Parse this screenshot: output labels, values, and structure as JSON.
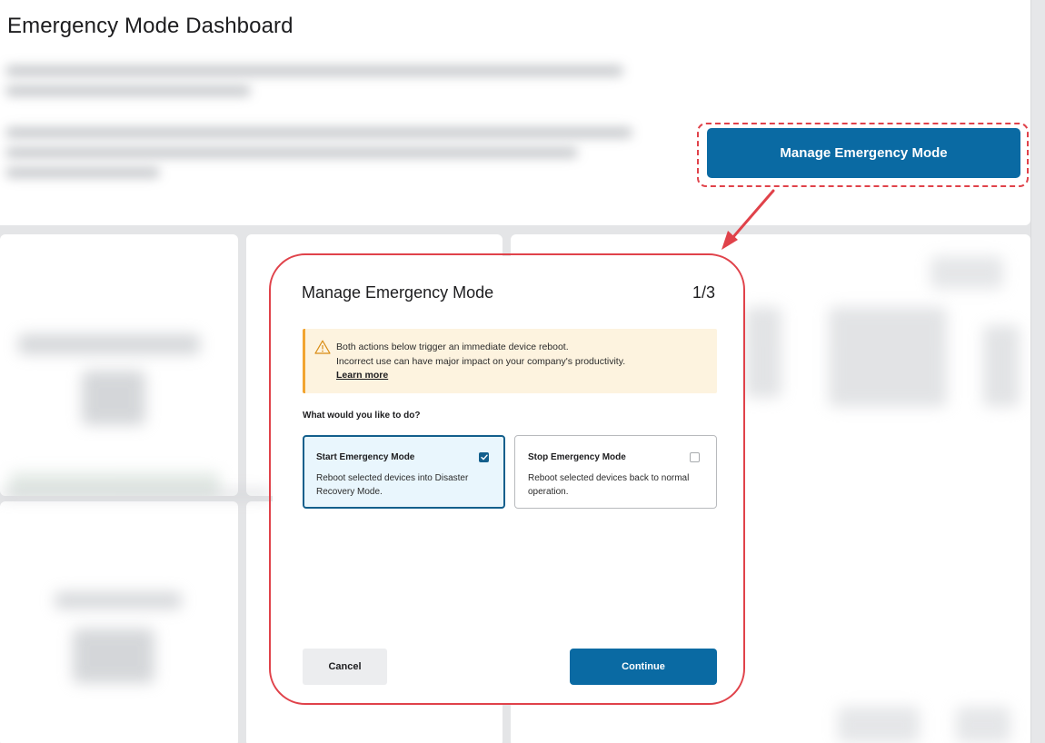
{
  "page": {
    "title": "Emergency Mode Dashboard",
    "manage_button": "Manage Emergency Mode"
  },
  "modal": {
    "title": "Manage Emergency Mode",
    "step": "1/3",
    "warning": {
      "line1": "Both actions below trigger an immediate device reboot.",
      "line2": "Incorrect use can have major impact on your company's productivity.",
      "link": "Learn more"
    },
    "question": "What would you like to do?",
    "options": [
      {
        "title": "Start Emergency Mode",
        "description": "Reboot selected devices into Disaster Recovery Mode.",
        "checked": true
      },
      {
        "title": "Stop Emergency Mode",
        "description": "Reboot selected devices back to normal operation.",
        "checked": false
      }
    ],
    "cancel": "Cancel",
    "continue": "Continue"
  },
  "colors": {
    "primary": "#0a6aa3",
    "annotation": "#e0424a",
    "warning_bg": "#fdf3df",
    "warning_accent": "#f2a531",
    "selected_bg": "#e9f6fd"
  },
  "icons": [
    "warning-icon",
    "checkmark-icon"
  ]
}
